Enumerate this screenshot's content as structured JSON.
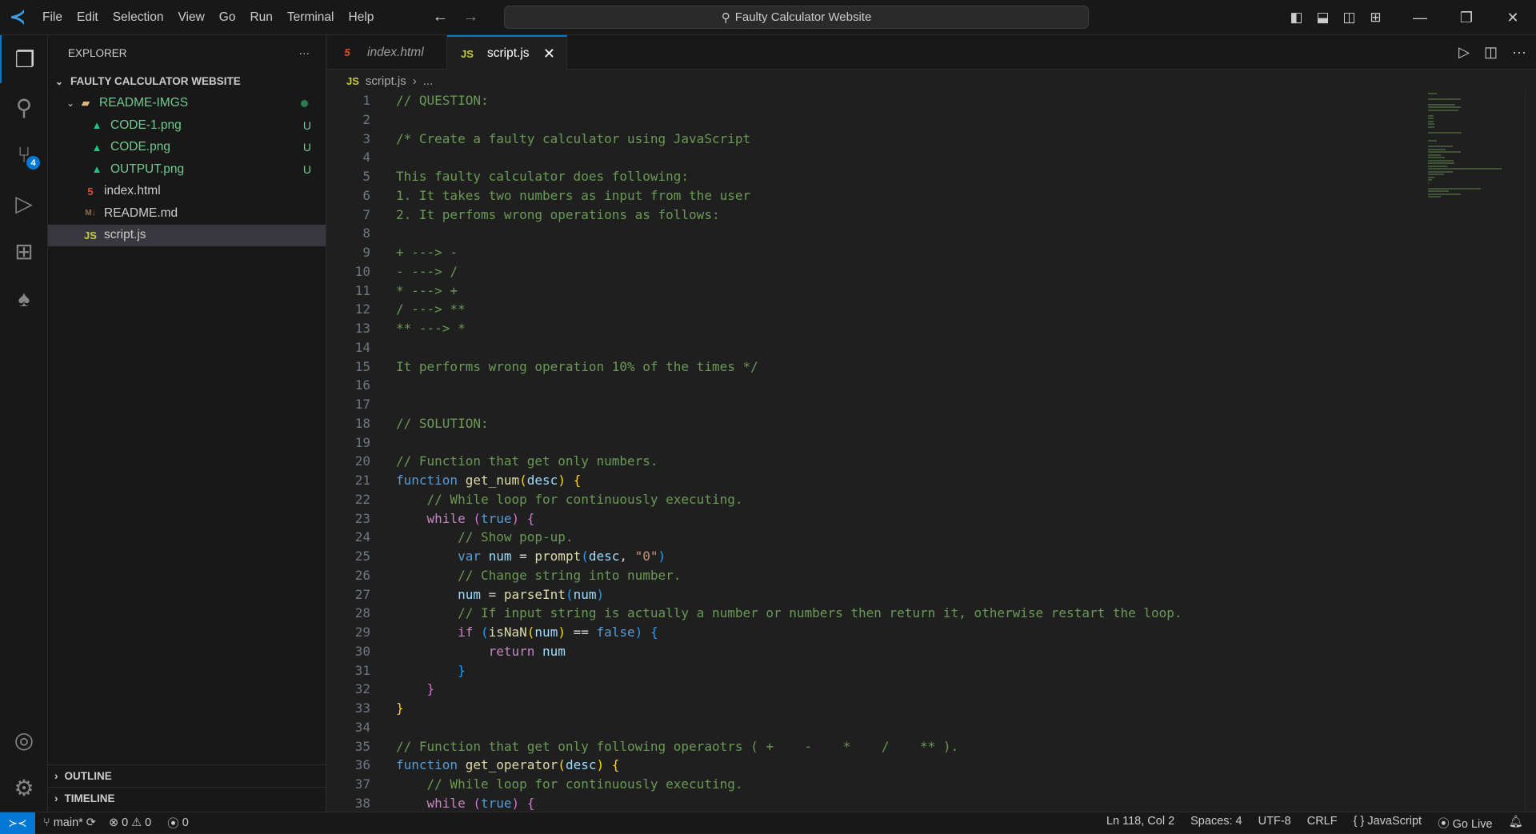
{
  "title": {
    "menu": [
      "File",
      "Edit",
      "Selection",
      "View",
      "Go",
      "Run",
      "Terminal",
      "Help"
    ],
    "search": "Faulty Calculator Website"
  },
  "sidebar": {
    "header": "EXPLORER",
    "root": "FAULTY CALCULATOR WEBSITE",
    "items": [
      {
        "name": "README-IMGS",
        "type": "folder",
        "depth": 1,
        "status": "dot",
        "green": true
      },
      {
        "name": "CODE-1.png",
        "type": "img",
        "depth": 2,
        "status": "U",
        "green": true
      },
      {
        "name": "CODE.png",
        "type": "img",
        "depth": 2,
        "status": "U",
        "green": true
      },
      {
        "name": "OUTPUT.png",
        "type": "img",
        "depth": 2,
        "status": "U",
        "green": true
      },
      {
        "name": "index.html",
        "type": "html",
        "depth": 1
      },
      {
        "name": "README.md",
        "type": "md",
        "depth": 1
      },
      {
        "name": "script.js",
        "type": "js",
        "depth": 1,
        "selected": true
      }
    ],
    "outline": "OUTLINE",
    "timeline": "TIMELINE"
  },
  "activity": {
    "scm_badge": "4"
  },
  "tabs": [
    {
      "label": "index.html",
      "icon": "html-icon"
    },
    {
      "label": "script.js",
      "icon": "js-icon",
      "active": true
    }
  ],
  "breadcrumb": {
    "file": "script.js",
    "rest": "..."
  },
  "code": [
    [
      [
        "c",
        "// QUESTION:"
      ]
    ],
    [],
    [
      [
        "c",
        "/* Create a faulty calculator using JavaScript"
      ]
    ],
    [],
    [
      [
        "c",
        "This faulty calculator does following:"
      ]
    ],
    [
      [
        "c",
        "1. It takes two numbers as input from the user"
      ]
    ],
    [
      [
        "c",
        "2. It perfoms wrong operations as follows:"
      ]
    ],
    [],
    [
      [
        "c",
        "+ ---> -"
      ]
    ],
    [
      [
        "c",
        "- ---> /"
      ]
    ],
    [
      [
        "c",
        "* ---> +"
      ]
    ],
    [
      [
        "c",
        "/ ---> **"
      ]
    ],
    [
      [
        "c",
        "** ---> *"
      ]
    ],
    [],
    [
      [
        "c",
        "It performs wrong operation 10% of the times */"
      ]
    ],
    [],
    [],
    [
      [
        "c",
        "// SOLUTION:"
      ]
    ],
    [],
    [
      [
        "c",
        "// Function that get only numbers."
      ]
    ],
    [
      [
        "k",
        "function "
      ],
      [
        "fn",
        "get_num"
      ],
      [
        "p1",
        "("
      ],
      [
        "v",
        "desc"
      ],
      [
        "p1",
        ")"
      ],
      [
        "t",
        " "
      ],
      [
        "p1",
        "{"
      ]
    ],
    [
      [
        "t",
        "    "
      ],
      [
        "c",
        "// While loop for continuously executing."
      ]
    ],
    [
      [
        "t",
        "    "
      ],
      [
        "ctl",
        "while "
      ],
      [
        "p2",
        "("
      ],
      [
        "k",
        "true"
      ],
      [
        "p2",
        ")"
      ],
      [
        "t",
        " "
      ],
      [
        "p2",
        "{"
      ]
    ],
    [
      [
        "t",
        "        "
      ],
      [
        "c",
        "// Show pop-up."
      ]
    ],
    [
      [
        "t",
        "        "
      ],
      [
        "k",
        "var "
      ],
      [
        "v",
        "num"
      ],
      [
        "t",
        " = "
      ],
      [
        "fn",
        "prompt"
      ],
      [
        "p3",
        "("
      ],
      [
        "v",
        "desc"
      ],
      [
        "t",
        ", "
      ],
      [
        "s",
        "\"0\""
      ],
      [
        "p3",
        ")"
      ]
    ],
    [
      [
        "t",
        "        "
      ],
      [
        "c",
        "// Change string into number."
      ]
    ],
    [
      [
        "t",
        "        "
      ],
      [
        "v",
        "num"
      ],
      [
        "t",
        " = "
      ],
      [
        "fn",
        "parseInt"
      ],
      [
        "p3",
        "("
      ],
      [
        "v",
        "num"
      ],
      [
        "p3",
        ")"
      ]
    ],
    [
      [
        "t",
        "        "
      ],
      [
        "c",
        "// If input string is actually a number or numbers then return it, otherwise restart the loop."
      ]
    ],
    [
      [
        "t",
        "        "
      ],
      [
        "ctl",
        "if "
      ],
      [
        "p3",
        "("
      ],
      [
        "fn",
        "isNaN"
      ],
      [
        "p1",
        "("
      ],
      [
        "v",
        "num"
      ],
      [
        "p1",
        ")"
      ],
      [
        "t",
        " == "
      ],
      [
        "k",
        "false"
      ],
      [
        "p3",
        ")"
      ],
      [
        "t",
        " "
      ],
      [
        "p3",
        "{"
      ]
    ],
    [
      [
        "t",
        "            "
      ],
      [
        "ctl",
        "return "
      ],
      [
        "v",
        "num"
      ]
    ],
    [
      [
        "t",
        "        "
      ],
      [
        "p3",
        "}"
      ]
    ],
    [
      [
        "t",
        "    "
      ],
      [
        "p2",
        "}"
      ]
    ],
    [
      [
        "p1",
        "}"
      ]
    ],
    [],
    [
      [
        "c",
        "// Function that get only following operaotrs ( +    -    *    /    ** )."
      ]
    ],
    [
      [
        "k",
        "function "
      ],
      [
        "fn",
        "get_operator"
      ],
      [
        "p1",
        "("
      ],
      [
        "v",
        "desc"
      ],
      [
        "p1",
        ")"
      ],
      [
        "t",
        " "
      ],
      [
        "p1",
        "{"
      ]
    ],
    [
      [
        "t",
        "    "
      ],
      [
        "c",
        "// While loop for continuously executing."
      ]
    ],
    [
      [
        "t",
        "    "
      ],
      [
        "ctl",
        "while "
      ],
      [
        "p2",
        "("
      ],
      [
        "k",
        "true"
      ],
      [
        "p2",
        ")"
      ],
      [
        "t",
        " "
      ],
      [
        "p2",
        "{"
      ]
    ]
  ],
  "status": {
    "branch": "main*",
    "errors": "0",
    "warnings": "0",
    "ports": "0",
    "position": "Ln 118, Col 2",
    "spaces": "Spaces: 4",
    "encoding": "UTF-8",
    "eol": "CRLF",
    "language": "JavaScript",
    "golive": "Go Live"
  }
}
